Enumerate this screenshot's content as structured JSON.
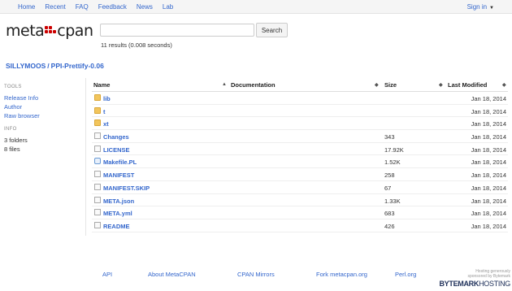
{
  "nav": {
    "links": [
      "Home",
      "Recent",
      "FAQ",
      "Feedback",
      "News",
      "Lab"
    ],
    "signin": "Sign in"
  },
  "logo": {
    "left": "meta",
    "right": "cpan"
  },
  "search": {
    "value": "",
    "button": "Search"
  },
  "results_text": "11 results (0.008 seconds)",
  "breadcrumb": {
    "author": "SILLYMOOS",
    "release": "PPI-Prettify-0.06"
  },
  "sidebar": {
    "tools_header": "TOOLS",
    "tools": [
      "Release Info",
      "Author",
      "Raw browser"
    ],
    "info_header": "INFO",
    "info": [
      "3 folders",
      "8 files"
    ]
  },
  "table": {
    "headers": {
      "name": "Name",
      "documentation": "Documentation",
      "size": "Size",
      "last_modified": "Last Modified"
    },
    "rows": [
      {
        "icon": "folder-icon",
        "name": "lib",
        "size": "",
        "date": "Jan 18, 2014"
      },
      {
        "icon": "folder-icon",
        "name": "t",
        "size": "",
        "date": "Jan 18, 2014"
      },
      {
        "icon": "folder-icon",
        "name": "xt",
        "size": "",
        "date": "Jan 18, 2014"
      },
      {
        "icon": "file-icon",
        "name": "Changes",
        "size": "343",
        "date": "Jan 18, 2014"
      },
      {
        "icon": "file-icon",
        "name": "LICENSE",
        "size": "17.92K",
        "date": "Jan 18, 2014"
      },
      {
        "icon": "perl-file-icon",
        "name": "Makefile.PL",
        "size": "1.52K",
        "date": "Jan 18, 2014"
      },
      {
        "icon": "file-icon",
        "name": "MANIFEST",
        "size": "258",
        "date": "Jan 18, 2014"
      },
      {
        "icon": "file-icon",
        "name": "MANIFEST.SKIP",
        "size": "67",
        "date": "Jan 18, 2014"
      },
      {
        "icon": "file-icon",
        "name": "META.json",
        "size": "1.33K",
        "date": "Jan 18, 2014"
      },
      {
        "icon": "file-icon",
        "name": "META.yml",
        "size": "683",
        "date": "Jan 18, 2014"
      },
      {
        "icon": "file-icon",
        "name": "README",
        "size": "426",
        "date": "Jan 18, 2014"
      }
    ]
  },
  "footer": {
    "links": [
      "API",
      "About MetaCPAN",
      "CPAN Mirrors",
      "Fork metacpan.org",
      "Perl.org"
    ],
    "hosting_line1": "Hosting generously",
    "hosting_line2": "sponsored by Bytemark",
    "hosting_brand_bold": "BYTEMARK",
    "hosting_brand_light": "HOSTING"
  },
  "colors": {
    "link": "#3366cc",
    "logo_accent": "#cc0000",
    "folder": "#f2c55c"
  }
}
